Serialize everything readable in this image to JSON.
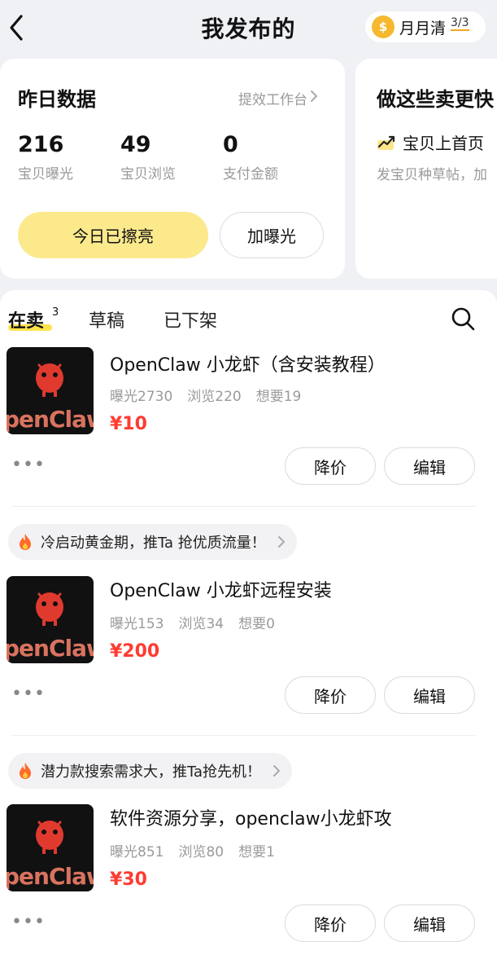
{
  "header": {
    "title": "我发布的",
    "badge_label": "月月清",
    "badge_count": "3/3"
  },
  "stats_card": {
    "title": "昨日数据",
    "link": "提效工作台",
    "stats": [
      {
        "value": "216",
        "label": "宝贝曝光"
      },
      {
        "value": "49",
        "label": "宝贝浏览"
      },
      {
        "value": "0",
        "label": "支付金额"
      }
    ],
    "primary_button": "今日已擦亮",
    "secondary_button": "加曝光"
  },
  "tips_card": {
    "title": "做这些卖更快",
    "item": "宝贝上首页",
    "sub": "发宝贝种草帖，加"
  },
  "tabs": {
    "on_sale": "在卖",
    "on_sale_count": "3",
    "drafts": "草稿",
    "removed": "已下架"
  },
  "thumb_text": "penClaw",
  "items": [
    {
      "title": "OpenClaw 小龙虾（含安装教程）",
      "exposure": "曝光2730",
      "views": "浏览220",
      "wants": "想要19",
      "price": "¥10",
      "btn_price": "降价",
      "btn_edit": "编辑",
      "tip": ""
    },
    {
      "title": "OpenClaw 小龙虾远程安装",
      "exposure": "曝光153",
      "views": "浏览34",
      "wants": "想要0",
      "price": "¥200",
      "btn_price": "降价",
      "btn_edit": "编辑",
      "tip": "冷启动黄金期，推Ta 抢优质流量！"
    },
    {
      "title": "软件资源分享，openclaw小龙虾攻",
      "exposure": "曝光851",
      "views": "浏览80",
      "wants": "想要1",
      "price": "¥30",
      "btn_price": "降价",
      "btn_edit": "编辑",
      "tip": "潜力款搜索需求大，推Ta抢先机！"
    }
  ],
  "colors": {
    "accent_yellow": "#fbe98c",
    "price_red": "#ff3b30",
    "coin": "#f5b82e"
  }
}
